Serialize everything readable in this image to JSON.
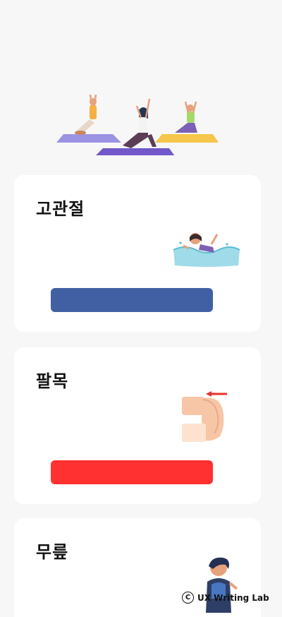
{
  "cards": [
    {
      "title": "고관절",
      "bar_color": "#4160a3",
      "illustration": "swimmer-illustration"
    },
    {
      "title": "팔목",
      "bar_color": "#ff3131",
      "illustration": "wrist-stretch-illustration"
    },
    {
      "title": "무릎",
      "bar_color": "",
      "illustration": "runner-illustration"
    }
  ],
  "hero": {
    "illustration": "yoga-group-illustration"
  },
  "watermark": {
    "copyright_symbol": "C",
    "text": "UX Writing Lab"
  }
}
